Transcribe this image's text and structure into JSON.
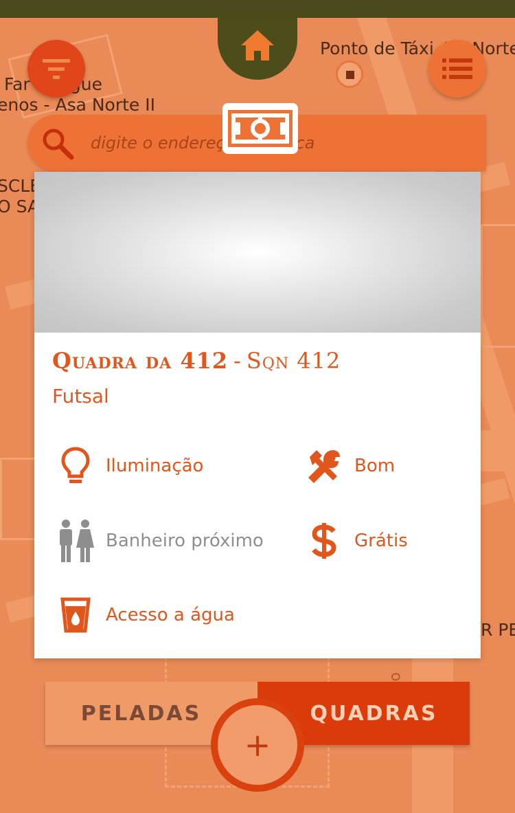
{
  "map": {
    "labels": {
      "taxi": "Ponto de Táxi 4 1 Norte",
      "place_line1": "Far  s Pague",
      "place_line2": "enos - Asa Norte II",
      "edge_left_1": "SCLE",
      "edge_left_2": "O SA",
      "edge_right": "R PE",
      "road_vertical": "orte"
    }
  },
  "search": {
    "placeholder": "digite o endereço ou busca",
    "value": ""
  },
  "card": {
    "name": "Quadra da 412",
    "separator": "-",
    "address": "Sqn 412",
    "sport": "Futsal",
    "features": {
      "lighting": "Iluminação",
      "condition": "Bom",
      "restroom": "Banheiro próximo",
      "price": "Grátis",
      "water": "Acesso a água"
    }
  },
  "toggle": {
    "peladas": "PELADAS",
    "quadras": "QUADRAS",
    "active": "quadras"
  },
  "add_button": "+",
  "colors": {
    "accent": "#e0561c",
    "primary": "#ee7236",
    "dark_header": "#4d4d1c",
    "active_tab": "#db3a0a",
    "disabled_text": "#8e8e8e"
  },
  "icons": {
    "home": "home-icon",
    "filter": "filter-icon",
    "list": "list-icon",
    "search": "search-icon",
    "field": "soccer-field-icon",
    "lightbulb": "lightbulb-icon",
    "tools": "tools-icon",
    "restroom": "restroom-icon",
    "dollar": "dollar-icon",
    "water": "water-cup-icon",
    "add": "plus-icon"
  }
}
